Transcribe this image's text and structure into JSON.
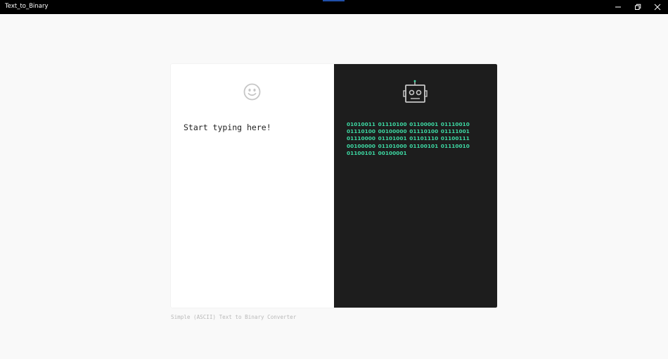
{
  "window": {
    "title": "Text_to_Binary",
    "controls": {
      "minimize_icon": "minimize-icon",
      "maximize_icon": "restore-icon",
      "close_icon": "close-icon"
    }
  },
  "input_panel": {
    "icon": "smiley-face-icon",
    "placeholder": "Start typing here!"
  },
  "output_panel": {
    "icon": "robot-icon",
    "binary_text": "01010011 01110100 01100001 01110010 01110100 00100000 01110100 01111001 01110000 01101001 01101110 01100111 00100000 01101000 01100101 01110010 01100101 00100001"
  },
  "caption": "Simple (ASCII) Text to Binary Converter",
  "colors": {
    "titlebar": "#000000",
    "background": "#f9f9f9",
    "output_bg": "#1d1d1d",
    "binary_green": "#3dd9a3",
    "icon_gray": "#c6c6c6"
  }
}
